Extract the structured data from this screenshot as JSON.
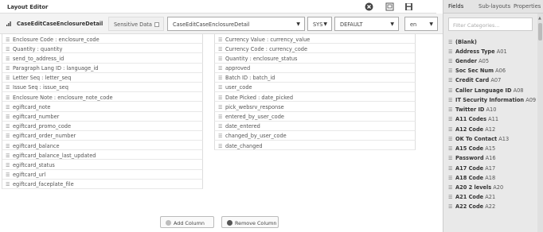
{
  "header": {
    "title": "Layout Editor"
  },
  "config": {
    "layout_name": "CaseEditCaseEnclosureDetail",
    "sensitive_label": "Sensitive Data",
    "layout_select": "CaseEditCaseEnclosureDetail",
    "sys_select": "SYS",
    "mode_select": "DEFAULT",
    "lang_select": "en"
  },
  "columns": {
    "left": [
      "Enclosure Code : enclosure_code",
      "Quantity : quantity",
      "send_to_address_id",
      "Paragraph Lang ID : language_id",
      "Letter Seq : letter_seq",
      "Issue Seq : issue_seq",
      "Enclosure Note : enclosure_note_code",
      "egiftcard_note",
      "egiftcard_number",
      "egiftcard_promo_code",
      "egiftcard_order_number",
      "egiftcard_balance",
      "egiftcard_balance_last_updated",
      "egiftcard_status",
      "egiftcard_url",
      "egiftcard_faceplate_file"
    ],
    "right": [
      "Currency Value : currency_value",
      "Currency Code : currency_code",
      "Quantity : enclosure_status",
      "approved",
      "Batch ID : batch_id",
      "user_code",
      "Date Picked : date_picked",
      "pick_websrv_response",
      "entered_by_user_code",
      "date_entered",
      "changed_by_user_code",
      "date_changed"
    ]
  },
  "buttons": {
    "add_column": "Add Column",
    "remove_column": "Remove Column"
  },
  "panel": {
    "tabs": [
      "Fields",
      "Sub-layouts",
      "Properties"
    ],
    "filter_placeholder": "Filter Categories...",
    "categories": [
      {
        "name": "(Blank)",
        "code": ""
      },
      {
        "name": "Address Type",
        "code": "A01"
      },
      {
        "name": "Gender",
        "code": "A05"
      },
      {
        "name": "Soc Sec Num",
        "code": "A06"
      },
      {
        "name": "Credit Card",
        "code": "A07"
      },
      {
        "name": "Caller Language ID",
        "code": "A08"
      },
      {
        "name": "IT Security Information",
        "code": "A09"
      },
      {
        "name": "Twitter ID",
        "code": "A10"
      },
      {
        "name": "A11 Codes",
        "code": "A11"
      },
      {
        "name": "A12 Code",
        "code": "A12"
      },
      {
        "name": "OK To Contact",
        "code": "A13"
      },
      {
        "name": "A15 Code",
        "code": "A15"
      },
      {
        "name": "Password",
        "code": "A16"
      },
      {
        "name": "A17 Code",
        "code": "A17"
      },
      {
        "name": "A18 Code",
        "code": "A18"
      },
      {
        "name": "A20 2 levels",
        "code": "A20"
      },
      {
        "name": "A21 Code",
        "code": "A21"
      },
      {
        "name": "A22 Code",
        "code": "A22"
      }
    ]
  },
  "colors": {
    "accent": "#4a90d9",
    "panel_bg": "#e9e9e9",
    "add_icon": "#bdbdbd",
    "remove_icon": "#555555"
  },
  "icons": {
    "close": "close-circle-icon",
    "preview": "preview-icon",
    "save": "save-icon"
  }
}
